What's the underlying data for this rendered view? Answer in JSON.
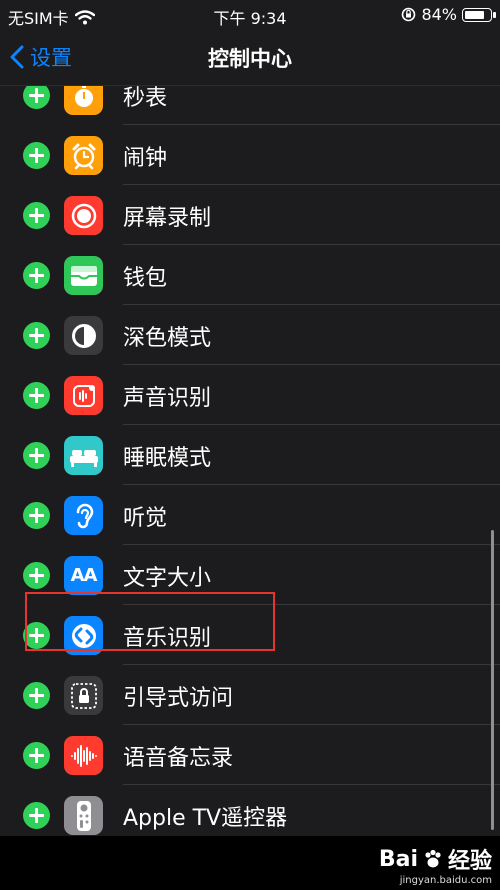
{
  "status_bar": {
    "carrier": "无SIM卡",
    "time": "下午 9:34",
    "battery": "84%",
    "battery_level": 0.84
  },
  "nav": {
    "back_label": "设置",
    "title": "控制中心"
  },
  "controls": [
    {
      "label": "秒表",
      "icon": "stopwatch-icon",
      "color": "#ff9f0a"
    },
    {
      "label": "闹钟",
      "icon": "alarm-icon",
      "color": "#ff9f0a"
    },
    {
      "label": "屏幕录制",
      "icon": "screen-record-icon",
      "color": "#ff3b30"
    },
    {
      "label": "钱包",
      "icon": "wallet-icon",
      "color": "#30c759"
    },
    {
      "label": "深色模式",
      "icon": "dark-mode-icon",
      "color": "#3a3a3c"
    },
    {
      "label": "声音识别",
      "icon": "sound-recognition-icon",
      "color": "#ff3b30"
    },
    {
      "label": "睡眠模式",
      "icon": "bed-icon",
      "color": "#30c8c8"
    },
    {
      "label": "听觉",
      "icon": "ear-icon",
      "color": "#0a84ff"
    },
    {
      "label": "文字大小",
      "icon": "text-size-icon",
      "color": "#0a84ff",
      "icon_text": "AA"
    },
    {
      "label": "音乐识别",
      "icon": "shazam-icon",
      "color": "#0a84ff"
    },
    {
      "label": "引导式访问",
      "icon": "lock-icon",
      "color": "#3a3a3c"
    },
    {
      "label": "语音备忘录",
      "icon": "waveform-icon",
      "color": "#ff3b30"
    },
    {
      "label": "Apple TV遥控器",
      "icon": "remote-icon",
      "color": "#8e8e93"
    }
  ],
  "watermark": {
    "brand_left": "Bai",
    "brand_right": "经验",
    "url": "jingyan.baidu.com"
  }
}
